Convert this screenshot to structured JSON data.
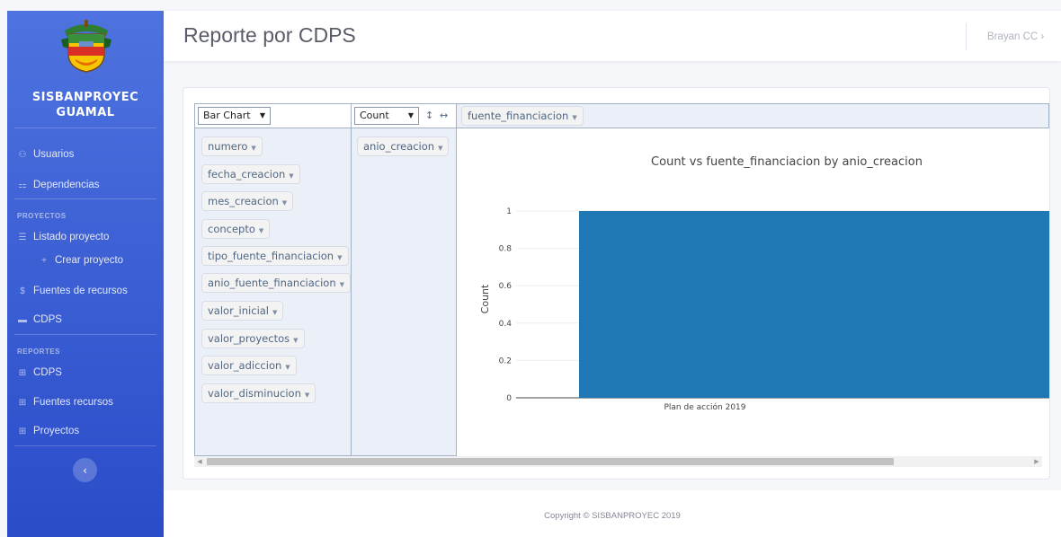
{
  "app": {
    "brand_line1": "SISBANPROYEC",
    "brand_line2": "GUAMAL"
  },
  "sidebar": {
    "items": [
      {
        "label": "Usuarios",
        "icon": "users-icon"
      },
      {
        "label": "Dependencias",
        "icon": "sitemap-icon"
      },
      {
        "label": "Listado proyecto",
        "icon": "list-icon"
      },
      {
        "label": "Crear proyecto",
        "icon": "plus-icon"
      },
      {
        "label": "Fuentes de recursos",
        "icon": "dollar-icon"
      },
      {
        "label": "CDPS",
        "icon": "card-icon"
      },
      {
        "label": "CDPS",
        "icon": "table-icon"
      },
      {
        "label": "Fuentes recursos",
        "icon": "table-icon"
      },
      {
        "label": "Proyectos",
        "icon": "table-icon"
      }
    ],
    "section_proyectos": "PROYECTOS",
    "section_reportes": "REPORTES",
    "collapse_symbol": "‹"
  },
  "header": {
    "title": "Reporte por CDPS",
    "user": "Brayan CC ›"
  },
  "pivot": {
    "renderer": "Bar Chart",
    "aggregator": "Count",
    "col_field": "fuente_financiacion",
    "row_field": "anio_creacion",
    "unused_fields": [
      "numero",
      "fecha_creacion",
      "mes_creacion",
      "concepto",
      "tipo_fuente_financiacion",
      "anio_fuente_financiacion",
      "valor_inicial",
      "valor_proyectos",
      "valor_adiccion",
      "valor_disminucion"
    ],
    "dropdown_caret": "▼",
    "pill_caret": "▼",
    "sort_rows": "↕",
    "sort_cols": "↔"
  },
  "chart_data": {
    "type": "bar",
    "title": "Count vs fuente_financiacion by anio_creacion",
    "ylabel": "Count",
    "xlabel": "",
    "categories": [
      "Plan de acción 2019"
    ],
    "values": [
      1
    ],
    "ylim": [
      0,
      1
    ],
    "y_ticks": [
      "0",
      "0.2",
      "0.4",
      "0.6",
      "0.8",
      "1"
    ],
    "grid": true,
    "colors": {
      "bar": "#1f77b4"
    }
  },
  "footer": {
    "text": "Copyright © SISBANPROYEC 2019"
  }
}
